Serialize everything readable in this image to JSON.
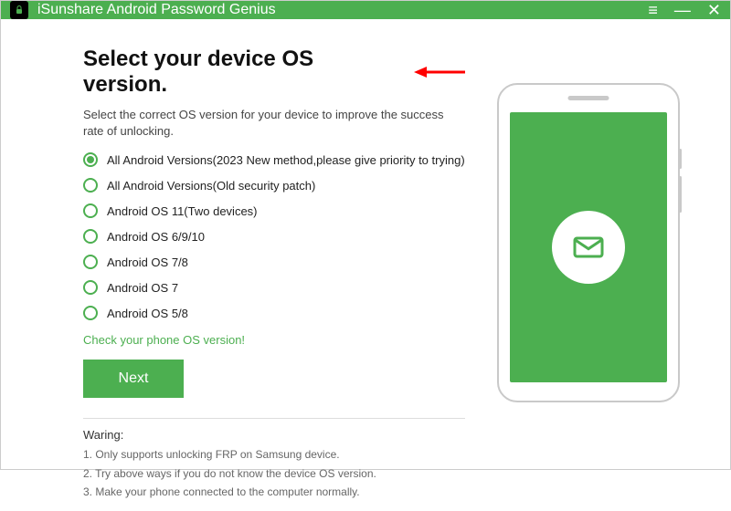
{
  "titlebar": {
    "title": "iSunshare Android Password Genius"
  },
  "main": {
    "heading": "Select your device OS version.",
    "subtitle": "Select the correct OS version for your device to improve the success rate of unlocking.",
    "options": [
      {
        "label": "All Android Versions(2023 New method,please give priority to trying)",
        "selected": true
      },
      {
        "label": "All Android Versions(Old security patch)",
        "selected": false
      },
      {
        "label": "Android OS 11(Two devices)",
        "selected": false
      },
      {
        "label": "Android OS 6/9/10",
        "selected": false
      },
      {
        "label": "Android OS 7/8",
        "selected": false
      },
      {
        "label": "Android OS 7",
        "selected": false
      },
      {
        "label": "Android OS 5/8",
        "selected": false
      }
    ],
    "check_link": "Check your phone OS version!",
    "next_label": "Next"
  },
  "warning": {
    "title": "Waring:",
    "items": [
      "1. Only supports unlocking FRP on Samsung device.",
      "2. Try above ways if you do not know the device OS version.",
      "3. Make your phone connected to the computer normally."
    ]
  },
  "colors": {
    "accent": "#4CAF50",
    "arrow": "#FF0000"
  }
}
